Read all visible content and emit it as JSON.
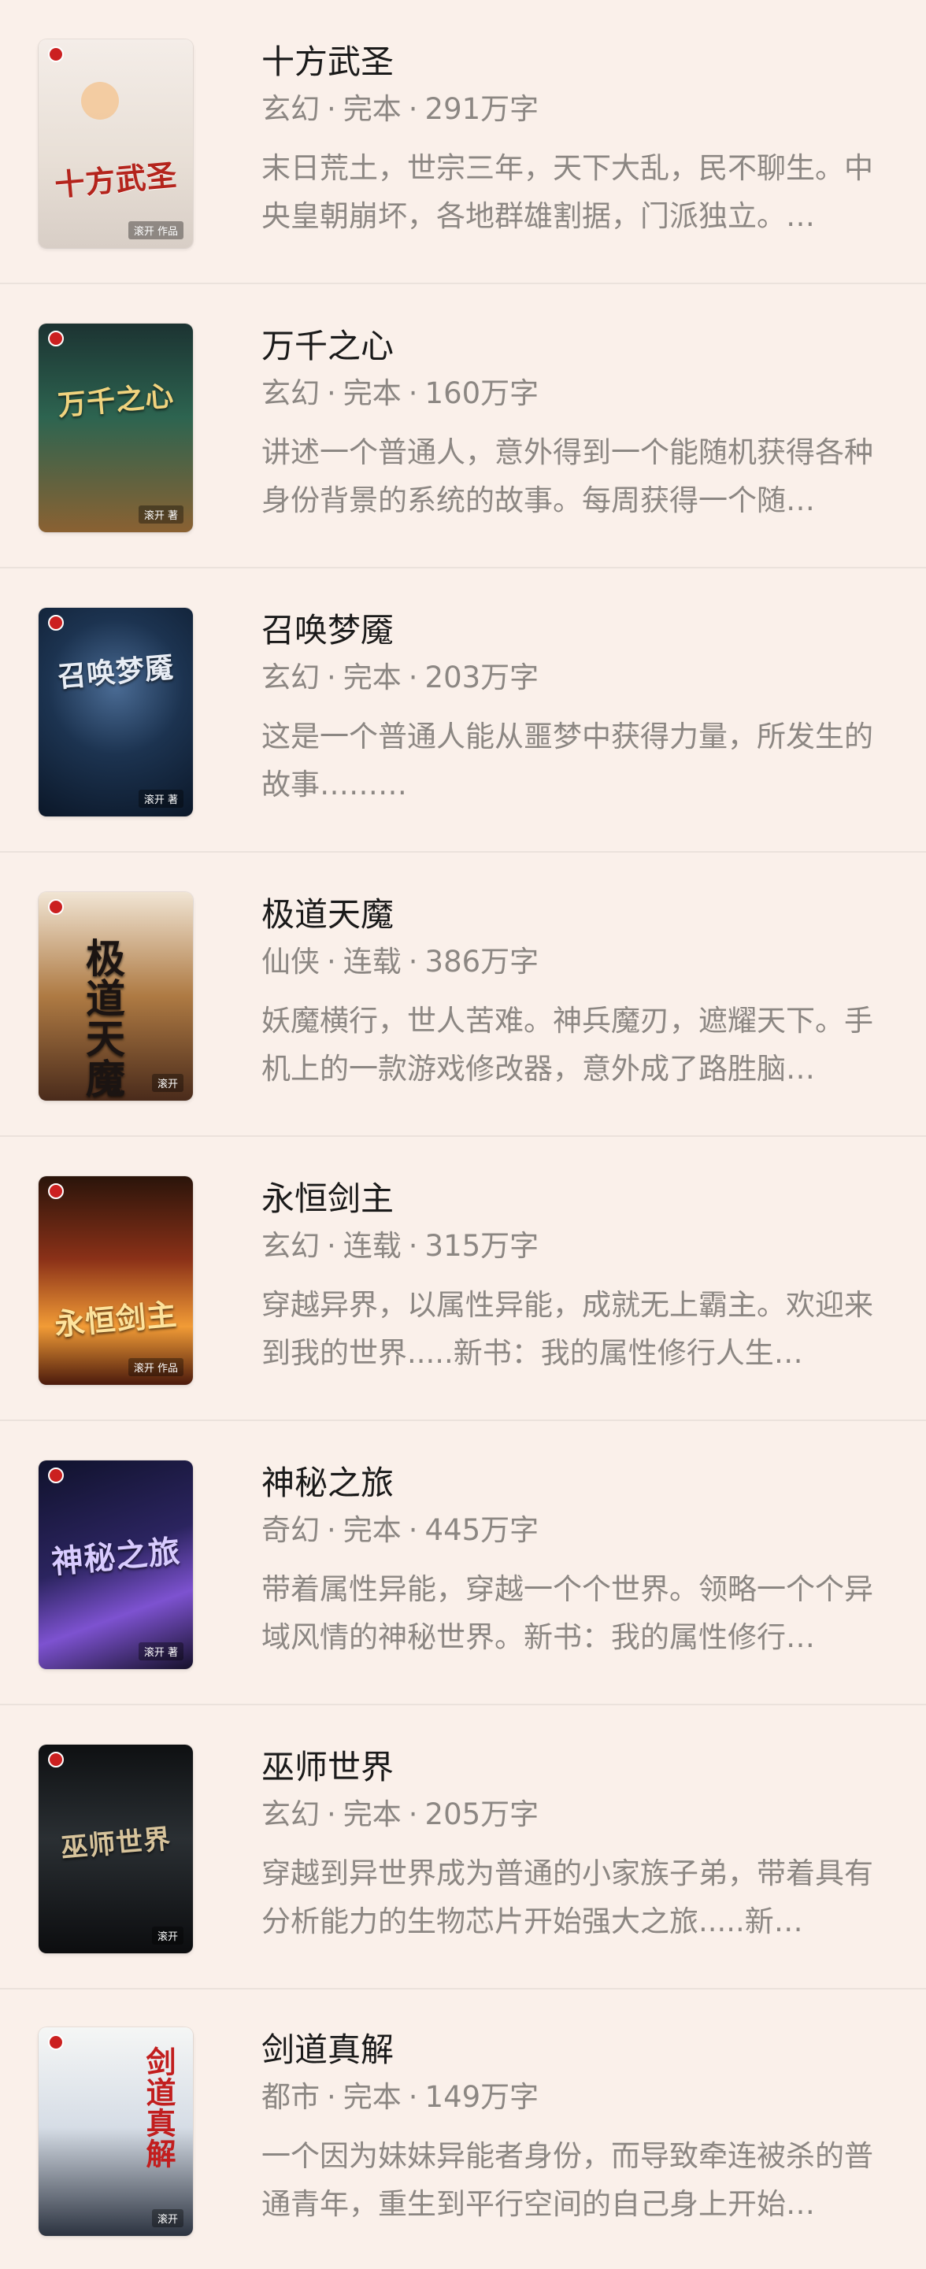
{
  "books": [
    {
      "title": "十方武圣",
      "category": "玄幻",
      "status": "完本",
      "word_count": "291万字",
      "summary": "末日荒土，世宗三年，天下大乱，民不聊生。中央皇朝崩坏，各地群雄割据，门派独立。…",
      "cover_text": "十方武圣",
      "author_tag": "滚开 作品"
    },
    {
      "title": "万千之心",
      "category": "玄幻",
      "status": "完本",
      "word_count": "160万字",
      "summary": "讲述一个普通人，意外得到一个能随机获得各种身份背景的系统的故事。每周获得一个随…",
      "cover_text": "万千之心",
      "author_tag": "滚开 著"
    },
    {
      "title": "召唤梦魇",
      "category": "玄幻",
      "status": "完本",
      "word_count": "203万字",
      "summary": "这是一个普通人能从噩梦中获得力量，所发生的故事………",
      "cover_text": "召唤梦魇",
      "author_tag": "滚开 著"
    },
    {
      "title": "极道天魔",
      "category": "仙侠",
      "status": "连载",
      "word_count": "386万字",
      "summary": "妖魔横行，世人苦难。神兵魔刃，遮耀天下。手机上的一款游戏修改器，意外成了路胜脑…",
      "cover_text": "极道天魔",
      "author_tag": "滚开"
    },
    {
      "title": "永恒剑主",
      "category": "玄幻",
      "status": "连载",
      "word_count": "315万字",
      "summary": "穿越异界，以属性异能，成就无上霸主。欢迎来到我的世界.....新书：我的属性修行人生…",
      "cover_text": "永恒剑主",
      "author_tag": "滚开 作品"
    },
    {
      "title": "神秘之旅",
      "category": "奇幻",
      "status": "完本",
      "word_count": "445万字",
      "summary": "带着属性异能，穿越一个个世界。领略一个个异域风情的神秘世界。新书：我的属性修行…",
      "cover_text": "神秘之旅",
      "author_tag": "滚开 著"
    },
    {
      "title": "巫师世界",
      "category": "玄幻",
      "status": "完本",
      "word_count": "205万字",
      "summary": "穿越到异世界成为普通的小家族子弟，带着具有分析能力的生物芯片开始强大之旅.....新…",
      "cover_text": "巫师世界",
      "author_tag": "滚开"
    },
    {
      "title": "剑道真解",
      "category": "都市",
      "status": "完本",
      "word_count": "149万字",
      "summary": "一个因为妹妹异能者身份，而导致牵连被杀的普通青年，重生到平行空间的自己身上开始…",
      "cover_text": "剑道真解",
      "author_tag": "滚开"
    }
  ],
  "meta_separator": "·",
  "colors": {
    "background": "#faf0ea",
    "title": "#1a1a1a",
    "secondary_text": "#8c8783",
    "divider": "#ebe2dc"
  }
}
